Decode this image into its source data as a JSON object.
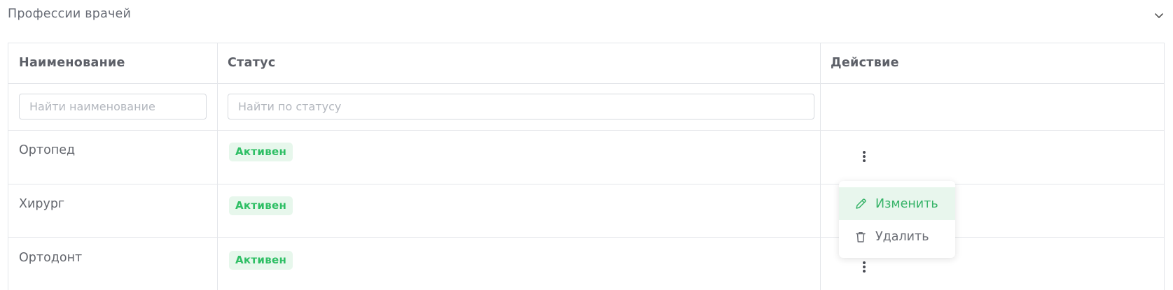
{
  "section": {
    "title": "Профессии врачей"
  },
  "table": {
    "columns": [
      "Наименование",
      "Статус",
      "Действие"
    ],
    "filters": {
      "name_placeholder": "Найти наименование",
      "status_placeholder": "Найти по статусу"
    },
    "rows": [
      {
        "name": "Ортопед",
        "status": "Активен"
      },
      {
        "name": "Хирург",
        "status": "Активен"
      },
      {
        "name": "Ортодонт",
        "status": "Активен"
      }
    ]
  },
  "action_menu": {
    "items": [
      {
        "label": "Изменить",
        "icon": "pencil-icon"
      },
      {
        "label": "Удалить",
        "icon": "trash-icon"
      }
    ]
  },
  "colors": {
    "accent": "#2fbf65",
    "badge_bg": "#e7f7ec",
    "border": "#e4e6ea"
  }
}
